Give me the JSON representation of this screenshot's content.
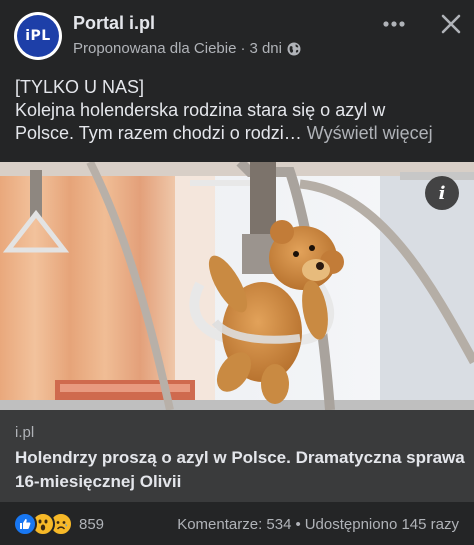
{
  "header": {
    "avatar_text": "iPL",
    "page_name": "Portal i.pl",
    "suggested_label": "Proponowana dla Ciebie",
    "separator": "·",
    "time": "3 dni",
    "privacy_icon": "globe-icon",
    "more_icon": "more-icon",
    "close_icon": "close-icon"
  },
  "post": {
    "lines": [
      "[TYLKO U NAS]",
      "Kolejna holenderska rodzina stara się o azyl w",
      "Polsce. Tym razem chodzi o rodzi…"
    ],
    "see_more": "Wyświetl więcej"
  },
  "image": {
    "description_icon": "info-icon",
    "info_glyph": "i"
  },
  "link_preview": {
    "domain": "i.pl",
    "title": "Holendrzy proszą o azyl w Polsce. Dramatyczna sprawa 16-miesięcznej Olivii"
  },
  "footer": {
    "reactions": [
      "like-icon",
      "wow-icon",
      "sad-icon"
    ],
    "reaction_count": "859",
    "comments": "Komentarze: 534",
    "dot": "•",
    "shares": "Udostępniono 145 razy"
  },
  "colors": {
    "background": "#242526",
    "link_box": "#3a3b3c",
    "primary_text": "#e4e6eb",
    "secondary_text": "#b0b3b8",
    "avatar_blue": "#1d3fa8",
    "like_blue": "#1877f2",
    "emoji_yellow": "#f7b928"
  }
}
